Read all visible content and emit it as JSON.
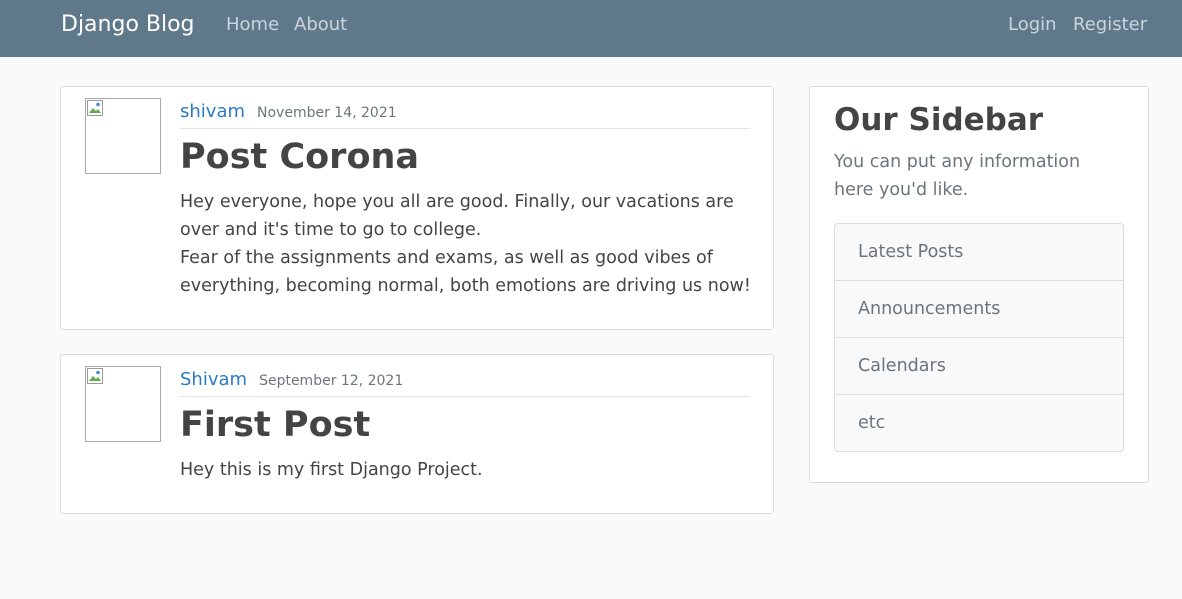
{
  "navbar": {
    "brand": "Django Blog",
    "links_left": [
      "Home",
      "About"
    ],
    "links_right": [
      "Login",
      "Register"
    ]
  },
  "posts": [
    {
      "author": "shivam",
      "date": "November 14, 2021",
      "title": "Post Corona",
      "content": "Hey everyone, hope you all are good. Finally, our vacations are over and it's time to go to college.\nFear of the assignments and exams, as well as good vibes of everything, becoming normal, both emotions are driving us now!",
      "avatar_icon": "broken-image-icon"
    },
    {
      "author": "Shivam",
      "date": "September 12, 2021",
      "title": "First Post",
      "content": "Hey this is my first Django Project.",
      "avatar_icon": "broken-image-icon"
    }
  ],
  "sidebar": {
    "title": "Our Sidebar",
    "text": "You can put any information here you'd like.",
    "items": [
      "Latest Posts",
      "Announcements",
      "Calendars",
      "etc"
    ]
  },
  "colors": {
    "navbar_bg": "#5f788a",
    "link_blue": "#2a7ac3",
    "page_bg": "#fafafa"
  }
}
